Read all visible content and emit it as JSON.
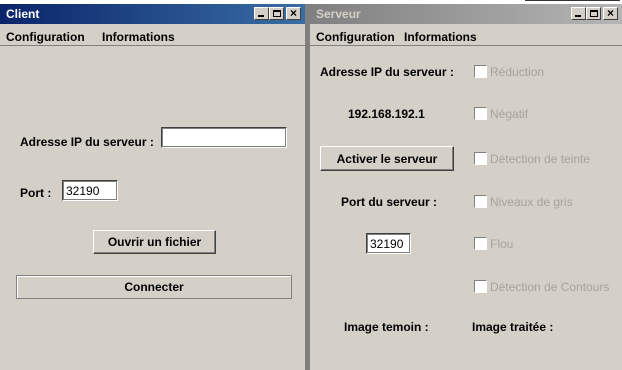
{
  "client": {
    "title": "Client",
    "menu": [
      "Configuration",
      "Informations"
    ],
    "ip_label": "Adresse IP du serveur :",
    "ip_value": "",
    "port_label": "Port :",
    "port_value": "32190",
    "open_file_label": "Ouvrir un fichier",
    "connect_label": "Connecter"
  },
  "serveur": {
    "title": "Serveur",
    "menu": [
      "Configuration",
      "Informations"
    ],
    "ip_label": "Adresse IP du serveur :",
    "ip_value": "192.168.192.1",
    "activate_label": "Activer le serveur",
    "port_label": "Port du serveur :",
    "port_value": "32190",
    "image_temoin_label": "Image temoin :",
    "image_traitee_label": "Image traitée :",
    "filters": [
      {
        "label": "Réduction",
        "checked": false,
        "enabled": false
      },
      {
        "label": "Négatif",
        "checked": false,
        "enabled": false
      },
      {
        "label": "Détection de teinte",
        "checked": false,
        "enabled": false
      },
      {
        "label": "Niveaux de gris",
        "checked": false,
        "enabled": false
      },
      {
        "label": "Flou",
        "checked": false,
        "enabled": false
      },
      {
        "label": "Détection de Contours",
        "checked": false,
        "enabled": false
      }
    ]
  },
  "window_controls": {
    "minimize": "_",
    "maximize": "□",
    "close": "×"
  },
  "colors": {
    "active_title": "#0a246a",
    "inactive_title": "#808080",
    "window_bg": "#d4d0c8",
    "disabled_text": "#a6a39b"
  }
}
